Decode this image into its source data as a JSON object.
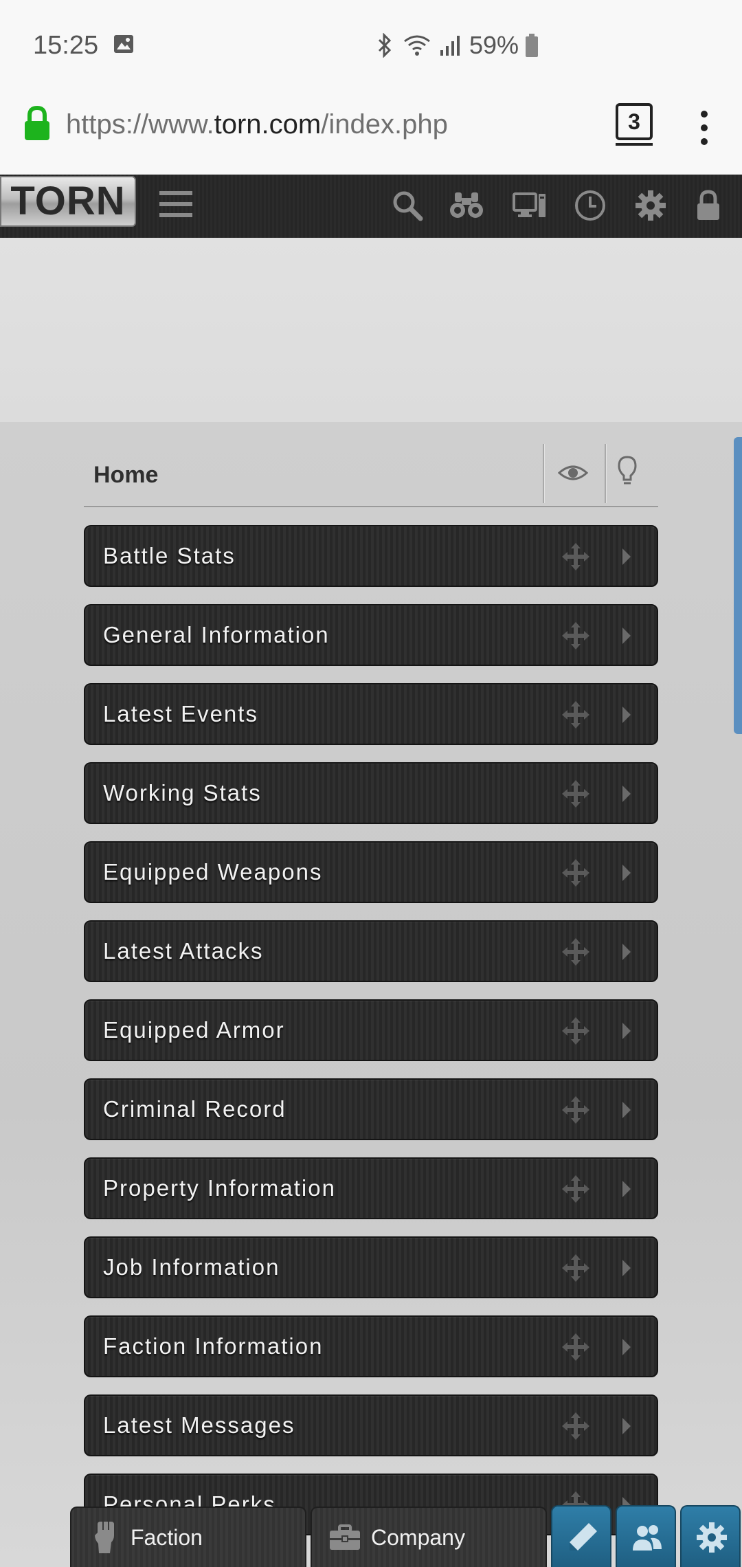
{
  "status_bar": {
    "time": "15:25",
    "battery": "59%",
    "icons": [
      "photo-icon",
      "bluetooth-icon",
      "wifi-icon",
      "signal-icon",
      "battery-icon"
    ]
  },
  "browser": {
    "url_prefix": "https://www.",
    "url_domain": "torn.com",
    "url_path": "/index.php",
    "tab_count": "3"
  },
  "torn_nav": {
    "logo": "TORN",
    "icons": [
      "hamburger-icon",
      "search-icon",
      "binoculars-icon",
      "computer-icon",
      "clock-icon",
      "gear-icon",
      "lock-icon"
    ]
  },
  "home": {
    "title": "Home"
  },
  "panels": [
    {
      "label": "Battle Stats"
    },
    {
      "label": "General Information"
    },
    {
      "label": "Latest Events"
    },
    {
      "label": "Working Stats"
    },
    {
      "label": "Equipped Weapons"
    },
    {
      "label": "Latest Attacks"
    },
    {
      "label": "Equipped Armor"
    },
    {
      "label": "Criminal Record"
    },
    {
      "label": "Property Information"
    },
    {
      "label": "Job Information"
    },
    {
      "label": "Faction Information"
    },
    {
      "label": "Latest Messages"
    },
    {
      "label": "Personal Perks"
    }
  ],
  "bottom_bar": {
    "faction_label": "Faction",
    "company_label": "Company",
    "buttons": [
      "pencil-icon",
      "people-icon",
      "gear-icon"
    ]
  },
  "colors": {
    "accent_blue": "#2f7ea8",
    "secure_lock_green": "#1db31d",
    "panel_dark": "#2b2b2b"
  }
}
